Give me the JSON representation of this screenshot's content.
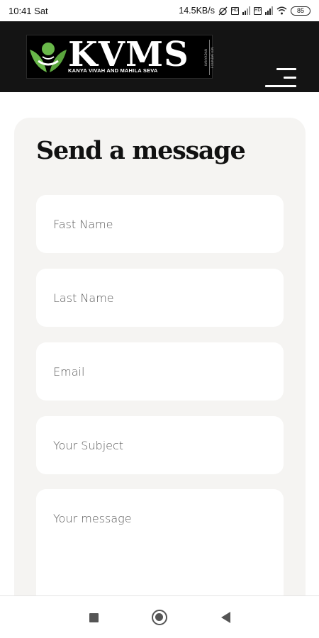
{
  "status_bar": {
    "time": "10:41 Sat",
    "network_speed": "14.5KB/s",
    "sim1_label": "HD",
    "sim2_label": "HD",
    "battery": "85",
    "icons": [
      "alarm-off-icon",
      "signal-icon",
      "signal-icon",
      "wifi-icon",
      "battery-icon"
    ]
  },
  "header": {
    "logo": {
      "text": "KVMS",
      "tagline": "KANYA VIVAH AND MAHILA SEVA",
      "vertical_text": "KANYADAN FOUNDATION"
    },
    "menu_icon": "hamburger-icon",
    "background": "#141414"
  },
  "form": {
    "title": "Send a message",
    "fields": {
      "first_name": {
        "placeholder": "Fast Name",
        "value": ""
      },
      "last_name": {
        "placeholder": "Last Name",
        "value": ""
      },
      "email": {
        "placeholder": "Email",
        "value": ""
      },
      "subject": {
        "placeholder": "Your Subject",
        "value": ""
      },
      "message": {
        "placeholder": "Your message",
        "value": ""
      }
    },
    "card_color": "#f5f4f2"
  },
  "nav_bar": {
    "buttons": [
      "recents-icon",
      "home-icon",
      "back-icon"
    ]
  }
}
